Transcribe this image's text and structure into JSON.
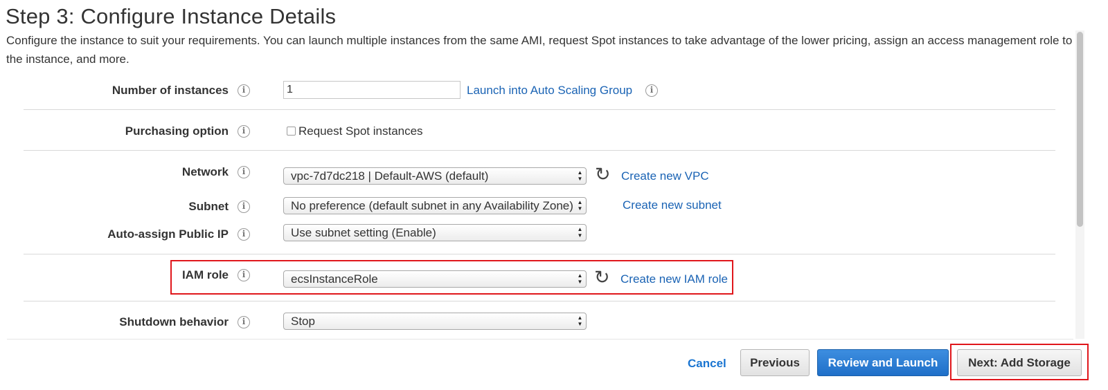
{
  "page": {
    "title": "Step 3: Configure Instance Details",
    "description": "Configure the instance to suit your requirements. You can launch multiple instances from the same AMI, request Spot instances to take advantage of the lower pricing, assign an access management role to the instance, and more."
  },
  "info_icon_glyph": "i",
  "refresh_icon_glyph": "↻",
  "fields": {
    "number_of_instances": {
      "label": "Number of instances",
      "value": "1",
      "link": "Launch into Auto Scaling Group"
    },
    "purchasing_option": {
      "label": "Purchasing option",
      "checkbox_label": "Request Spot instances",
      "checked": false
    },
    "network": {
      "label": "Network",
      "value": "vpc-7d7dc218 | Default-AWS (default)",
      "link": "Create new VPC"
    },
    "subnet": {
      "label": "Subnet",
      "value": "No preference (default subnet in any Availability Zone)",
      "link": "Create new subnet"
    },
    "auto_assign_ip": {
      "label": "Auto-assign Public IP",
      "value": "Use subnet setting (Enable)"
    },
    "iam_role": {
      "label": "IAM role",
      "value": "ecsInstanceRole",
      "link": "Create new IAM role"
    },
    "shutdown_behavior": {
      "label": "Shutdown behavior",
      "value": "Stop"
    }
  },
  "footer": {
    "cancel": "Cancel",
    "previous": "Previous",
    "review_and_launch": "Review and Launch",
    "next": "Next: Add Storage"
  },
  "colors": {
    "link": "#1a63b4",
    "primary_button": "#1f6fc8",
    "highlight": "#e0161b"
  }
}
